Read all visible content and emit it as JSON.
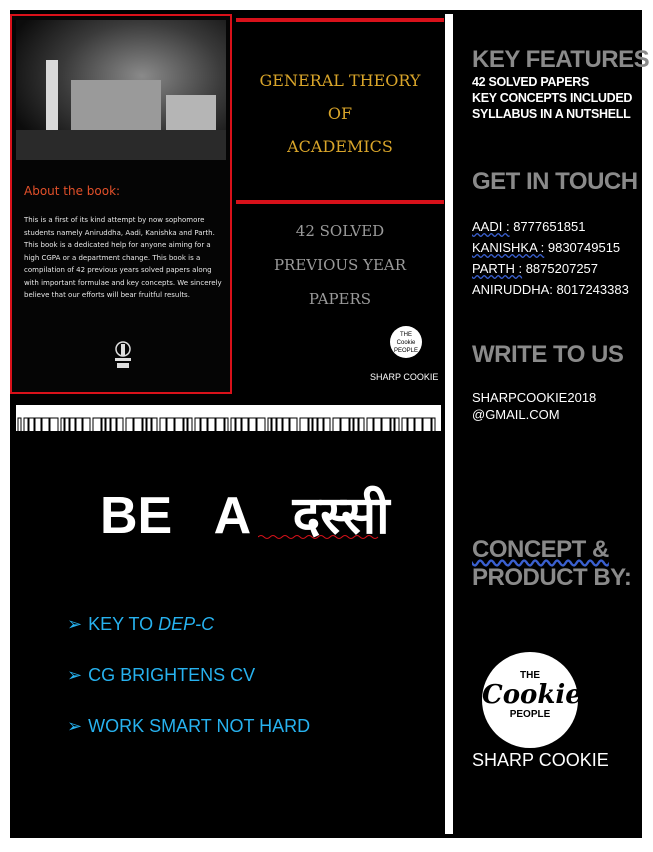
{
  "cover": {
    "about_title": "About the book:",
    "about_text": "This is a first of its kind attempt by now sophomore students namely Aniruddha, Aadi, Kanishka and Parth. This book is a dedicated help for anyone aiming for a high CGPA or a department change. This book is a compilation of 42 previous years solved papers along with important formulae and key concepts. We sincerely believe that our efforts will bear fruitful results.",
    "title_line1": "GENERAL THEORY",
    "title_line2": "OF",
    "title_line3": "ACADEMICS",
    "sub_line1": "42 SOLVED",
    "sub_line2": "PREVIOUS YEAR",
    "sub_line3": "PAPERS",
    "logo_text": "THE Cookie PEOPLE",
    "brand": "SHARP COOKIE"
  },
  "slogan": {
    "text": "BE   A   दस्सी"
  },
  "bullets": [
    {
      "prefix": "KEY TO ",
      "emph": "DEP-C"
    },
    {
      "prefix": "CG BRIGHTENS CV",
      "emph": ""
    },
    {
      "prefix": "WORK SMART NOT HARD",
      "emph": ""
    }
  ],
  "sidebar": {
    "features_heading": "KEY FEATURES",
    "features": [
      "42 SOLVED PAPERS",
      "KEY CONCEPTS INCLUDED",
      "SYLLABUS IN A NUTSHELL"
    ],
    "contact_heading": "GET IN TOUCH",
    "contacts": [
      {
        "name": "AADI :",
        "phone": " 8777651851"
      },
      {
        "name": "KANISHKA :",
        "phone": " 9830749515"
      },
      {
        "name": "PARTH :",
        "phone": " 8875207257"
      },
      {
        "name": "ANIRUDDHA:",
        "phone": " 8017243383"
      }
    ],
    "write_heading": "WRITE TO US",
    "email_line1": "SHARPCOOKIE2018",
    "email_line2": "@GMAIL.COM",
    "concept_line1": "CONCEPT &",
    "concept_line2": "PRODUCT BY:",
    "logo_the": "THE",
    "logo_cookie": "Cookie",
    "logo_people": "PEOPLE",
    "brand": "SHARP COOKIE"
  },
  "colors": {
    "background": "#000000",
    "accent_red": "#d8111a",
    "title_gold": "#d9a52a",
    "bullet_blue": "#27b2ef",
    "heading_gray": "#8a8a8a"
  }
}
